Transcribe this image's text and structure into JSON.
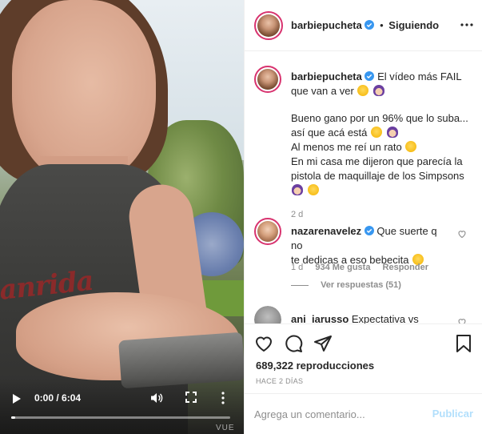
{
  "colors": {
    "text": "#262626",
    "secondary": "#8e8e8e",
    "verified": "#3897f0",
    "publish_disabled": "#b2dffc",
    "story_ring": "#d8336f",
    "border": "#efefef"
  },
  "video": {
    "time_display": "0:00 / 6:04",
    "progress": 0.0,
    "shirt_print": "anrida",
    "watermark": "VUE",
    "icons": [
      "play-icon",
      "volume-icon",
      "fullscreen-icon",
      "more-options-vertical-icon"
    ]
  },
  "header": {
    "username": "barbiepucheta",
    "separator": "•",
    "follow_status": "Siguiendo",
    "icons": [
      "verified-badge-icon",
      "more-options-icon"
    ]
  },
  "caption": {
    "username": "barbiepucheta",
    "line1_text": "El vídeo más FAIL",
    "line2_text": "que van a ver",
    "line3_text": "Bueno gano por un 96% que lo suba...",
    "line4_text": "así que acá está",
    "line5_text": "Al menos me reí un rato",
    "line6_text": "En mi casa me dijeron que parecía la",
    "line7_text": "pistola de maquillaje de los Simpsons",
    "time": "2 d",
    "emojis": [
      "grinning-sweat-face",
      "woman-facepalming",
      "woman-gesturing-no",
      "rolling-on-floor-laughing",
      "sad-face"
    ]
  },
  "comments": [
    {
      "username": "nazarenavelez",
      "text_line1": "Que suerte q no",
      "text_line2": "te dedicas a eso bebecita",
      "time": "1 d",
      "likes": "934 Me gusta",
      "reply_label": "Responder",
      "view_replies": "Ver respuestas (51)"
    },
    {
      "username": "ani_iarusso",
      "text": "Expectativa vs"
    }
  ],
  "actions": {
    "views": "689,322 reproducciones",
    "date": "HACE 2 DÍAS",
    "icons": [
      "heart-icon",
      "comment-icon",
      "share-icon",
      "bookmark-icon"
    ]
  },
  "add_comment": {
    "placeholder": "Agrega un comentario...",
    "publish_label": "Publicar"
  }
}
